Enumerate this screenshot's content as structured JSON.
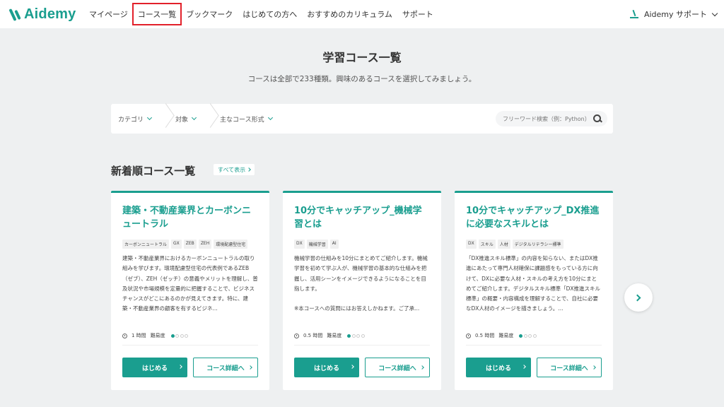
{
  "header": {
    "logo_text": "Aidemy",
    "nav": [
      "マイページ",
      "コース一覧",
      "ブックマーク",
      "はじめての方へ",
      "おすすめのカリキュラム",
      "サポート"
    ],
    "support_label": "Aidemy サポート"
  },
  "hero": {
    "title": "学習コース一覧",
    "subtitle": "コースは全部で233種類。興味のあるコースを選択してみましょう。"
  },
  "filters": {
    "items": [
      "カテゴリ",
      "対象",
      "主なコース形式"
    ],
    "search_placeholder": "フリーワード検索（例：Python）"
  },
  "section": {
    "title": "新着順コース一覧",
    "see_all": "すべて表示"
  },
  "cards": [
    {
      "title": "建築・不動産業界とカーボンニュートラル",
      "tags": [
        "カーボンニュートラル",
        "GX",
        "ZEB",
        "ZEH",
        "環境配慮型住宅"
      ],
      "description": "建築・不動産業界におけるカーボンニュートラルの取り組みを学びます。環境配慮型住宅の代表例であるZEB（ゼブ）、ZEH（ゼッチ）の意義やメリットを理解し、普及状況や市場規模を定量的に把握することで、ビジネスチャンスがどこにあるのかが見えてきます。特に、建築・不動産業界の顧客を有するビジネ...",
      "duration": "1 時間",
      "difficulty_label": "難易度",
      "difficulty": 1,
      "start_label": "はじめる",
      "detail_label": "コース詳細へ"
    },
    {
      "title": "10分でキャッチアップ_機械学習とは",
      "tags": [
        "DX",
        "機械学習",
        "AI"
      ],
      "description": "機械学習の仕組みを10分にまとめてご紹介します。機械学習を初めて学ぶ人が、機械学習の基本的な仕組みを把握し、活用シーンをイメージできるようになることを目指します。\n\n※本コースへの質問にはお答えしかねます。ご了承...",
      "duration": "0.5 時間",
      "difficulty_label": "難易度",
      "difficulty": 1,
      "start_label": "はじめる",
      "detail_label": "コース詳細へ"
    },
    {
      "title": "10分でキャッチアップ_DX推進に必要なスキルとは",
      "tags": [
        "DX",
        "スキル",
        "人材",
        "デジタルリテラシー標準"
      ],
      "description": "「DX推進スキル標準」の内容を知らない、またはDX推進にあたって専門人材確保に課題感をもっている方に向けて、DXに必要な人材・スキルの考え方を10分にまとめてご紹介します。デジタルスキル標準「DX推進スキル標準」の概要・内容構成を理解することで、自社に必要なDX人材のイメージを描きましょう。...",
      "duration": "0.5 時間",
      "difficulty_label": "難易度",
      "difficulty": 1,
      "start_label": "はじめる",
      "detail_label": "コース詳細へ"
    }
  ],
  "colors": {
    "accent": "#1a9e8f",
    "highlight": "#e2202a",
    "background": "#eef0f1"
  },
  "icons": {
    "logo": "aidemy-logo-icon",
    "support": "support-icon",
    "search": "search-icon",
    "clock": "clock-icon",
    "next": "chevron-right-icon"
  }
}
